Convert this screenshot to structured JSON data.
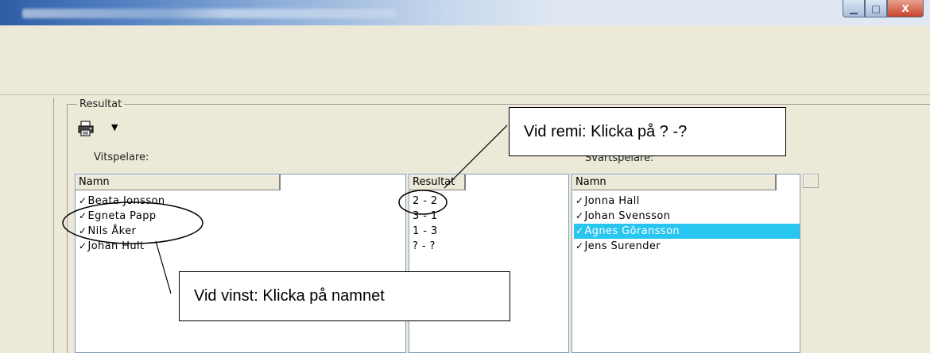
{
  "window": {
    "buttons": {
      "minimize": "▁",
      "maximize": "□",
      "close": "X"
    }
  },
  "results": {
    "group_label": "Resultat",
    "white_label": "Vitspelare:",
    "black_label": "Svartspelare:",
    "white_column": "Namn",
    "result_column": "Resultat",
    "black_column": "Namn",
    "white_players": [
      "Beata Jonsson",
      "Egneta Papp",
      "Nils Åker",
      "Johan Hult"
    ],
    "scores": [
      "2 - 2",
      "3 - 1",
      "1 - 3",
      "? - ?"
    ],
    "black_players": [
      "Jonna Hall",
      "Johan Svensson",
      "Agnes Göransson",
      "Jens Surender"
    ],
    "selected_black_index": 2,
    "check_mark": "✓"
  },
  "callouts": {
    "remi": "Vid remi: Klicka på ? -?",
    "win": "Vid vinst: Klicka på namnet"
  },
  "icons": {
    "print": "printer-icon",
    "dropdown": "chevron-down-icon"
  },
  "colors": {
    "selection": "#28c5f0",
    "title_start": "#2e5da5",
    "close": "#c7432a"
  }
}
